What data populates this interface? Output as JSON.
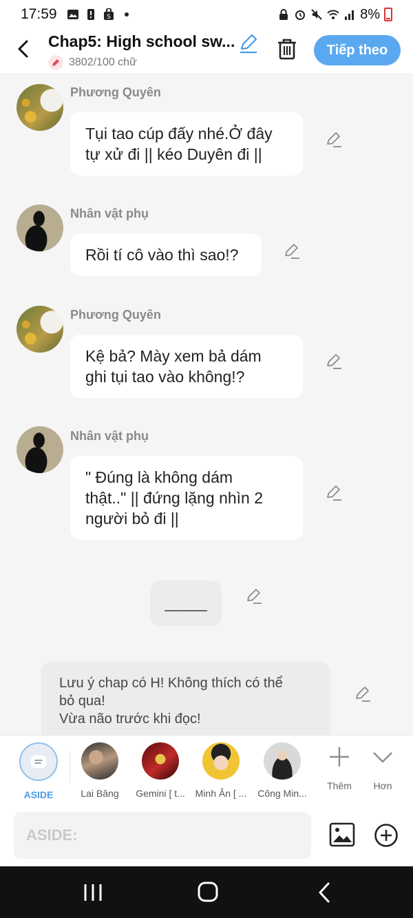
{
  "status_bar": {
    "time": "17:59",
    "battery": "8%"
  },
  "header": {
    "title": "Chap5: High school sw...",
    "word_count": "3802/100 chữ",
    "next_label": "Tiếp theo"
  },
  "messages": [
    {
      "speaker": "Phương Quyên",
      "avatar": "flower",
      "lines": [
        "Tụi tao cúp đấy nhé.Ở đây",
        "tự xử đi || kéo Duyên đi ||"
      ]
    },
    {
      "speaker": "Nhân vật phụ",
      "avatar": "shadow",
      "lines": [
        "Rồi tí cô vào thì sao!?"
      ]
    },
    {
      "speaker": "Phương Quyên",
      "avatar": "flower",
      "lines": [
        "Kệ bả? Mày xem bả dám",
        "ghi tụi tao vào không!?"
      ]
    },
    {
      "speaker": "Nhân vật phụ",
      "avatar": "shadow",
      "lines": [
        "\" Đúng là không dám",
        "thật..\" || đứng lặng nhìn 2",
        "người bỏ đi ||"
      ]
    }
  ],
  "divider_text": "_____",
  "note_lines": [
    "Lưu ý chap có H! Không thích có thể",
    "bỏ qua!",
    "Vừa não trước khi đọc!"
  ],
  "characters": [
    {
      "name": "ASIDE"
    },
    {
      "name": "Lai Băng"
    },
    {
      "name": "Gemini [ t..."
    },
    {
      "name": "Minh Ân [ ..."
    },
    {
      "name": "Công Min..."
    }
  ],
  "more": {
    "add_label": "Thêm",
    "expand_label": "Hơn"
  },
  "input": {
    "placeholder": "ASIDE:"
  }
}
